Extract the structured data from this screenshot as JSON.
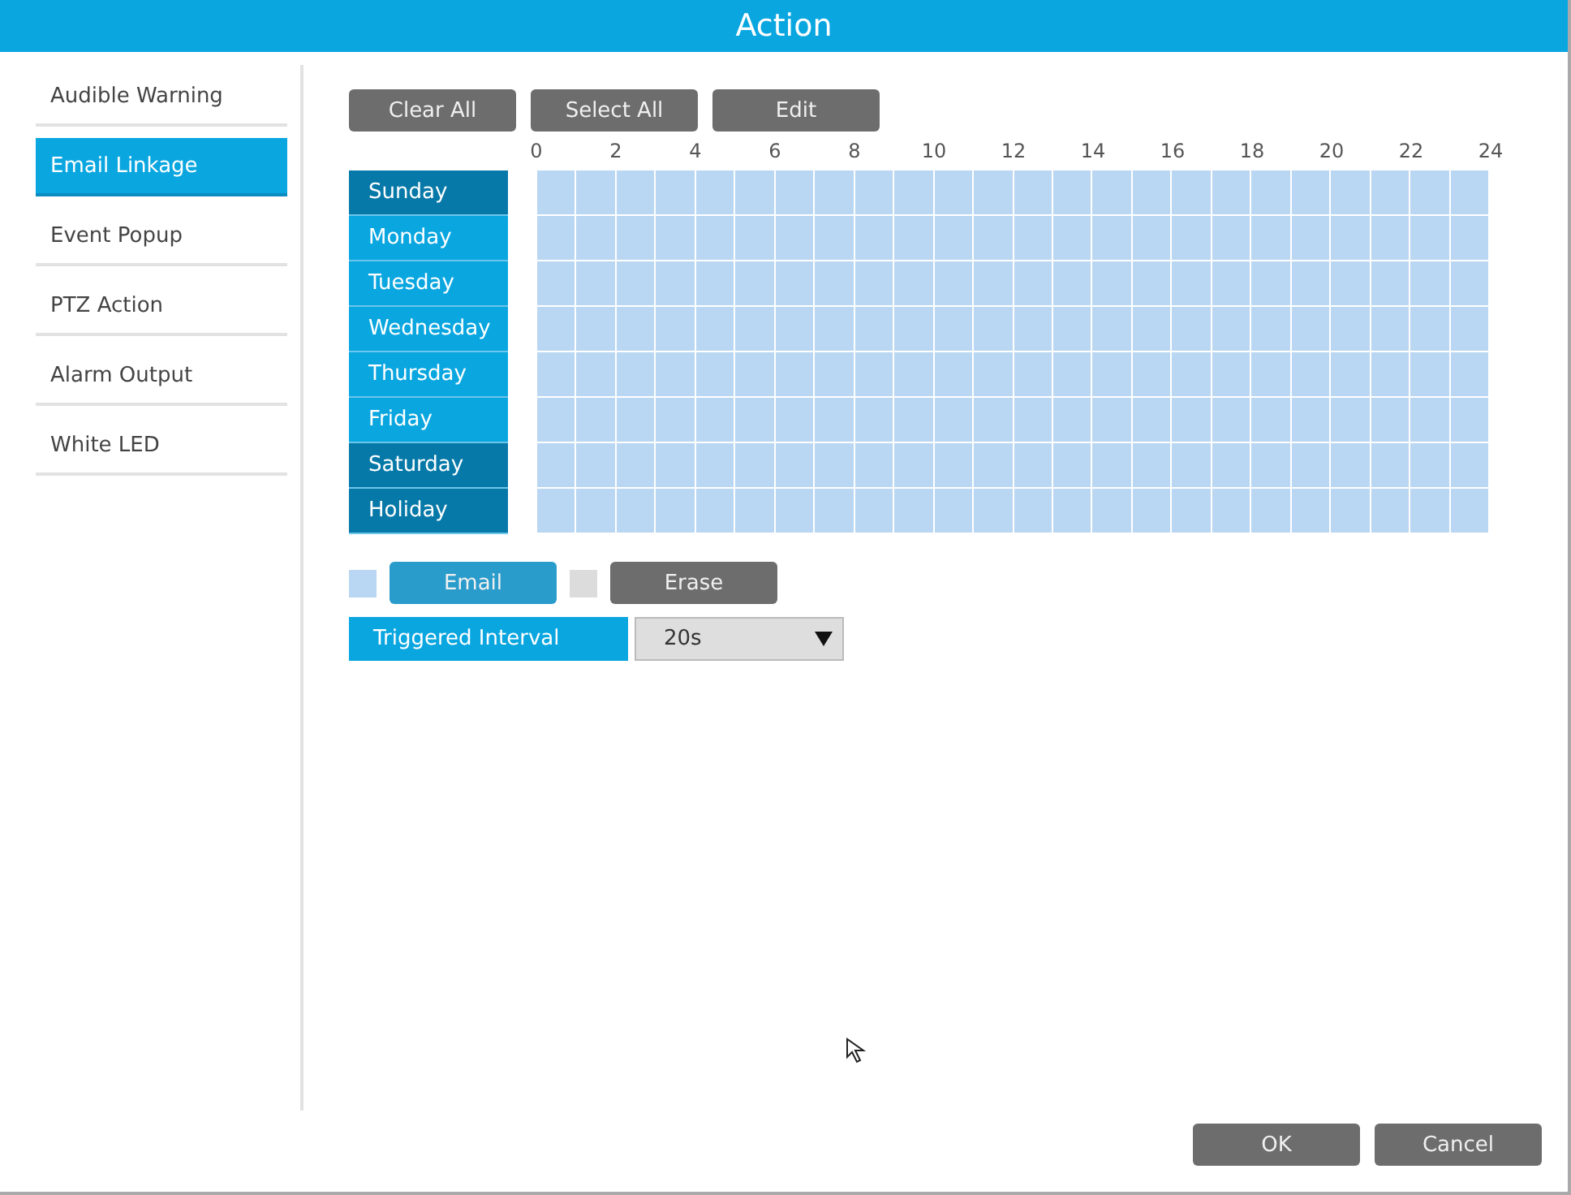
{
  "window": {
    "title": "Action"
  },
  "sidebar": {
    "items": [
      {
        "label": "Audible Warning",
        "selected": false
      },
      {
        "label": "Email Linkage",
        "selected": true
      },
      {
        "label": "Event Popup",
        "selected": false
      },
      {
        "label": "PTZ Action",
        "selected": false
      },
      {
        "label": "Alarm Output",
        "selected": false
      },
      {
        "label": "White LED",
        "selected": false
      }
    ]
  },
  "toolbar": [
    "Clear All",
    "Select All",
    "Edit"
  ],
  "schedule": {
    "hour_labels": [
      "0",
      "2",
      "4",
      "6",
      "8",
      "10",
      "12",
      "14",
      "16",
      "18",
      "20",
      "22",
      "24"
    ],
    "days": [
      {
        "label": "Sunday",
        "selected": true,
        "scheduled": true
      },
      {
        "label": "Monday",
        "selected": false,
        "scheduled": true
      },
      {
        "label": "Tuesday",
        "selected": false,
        "scheduled": true
      },
      {
        "label": "Wednesday",
        "selected": false,
        "scheduled": true
      },
      {
        "label": "Thursday",
        "selected": false,
        "scheduled": true
      },
      {
        "label": "Friday",
        "selected": false,
        "scheduled": true
      },
      {
        "label": "Saturday",
        "selected": true,
        "scheduled": true
      },
      {
        "label": "Holiday",
        "selected": true,
        "scheduled": true
      }
    ]
  },
  "legend": [
    {
      "label": "Email",
      "color": "#b9d7f2",
      "selected": true
    },
    {
      "label": "Erase",
      "color": "#dcdcdc",
      "selected": false
    }
  ],
  "triggered_interval": {
    "label": "Triggered Interval",
    "value": "20s"
  },
  "buttons": [
    "OK",
    "Cancel"
  ]
}
